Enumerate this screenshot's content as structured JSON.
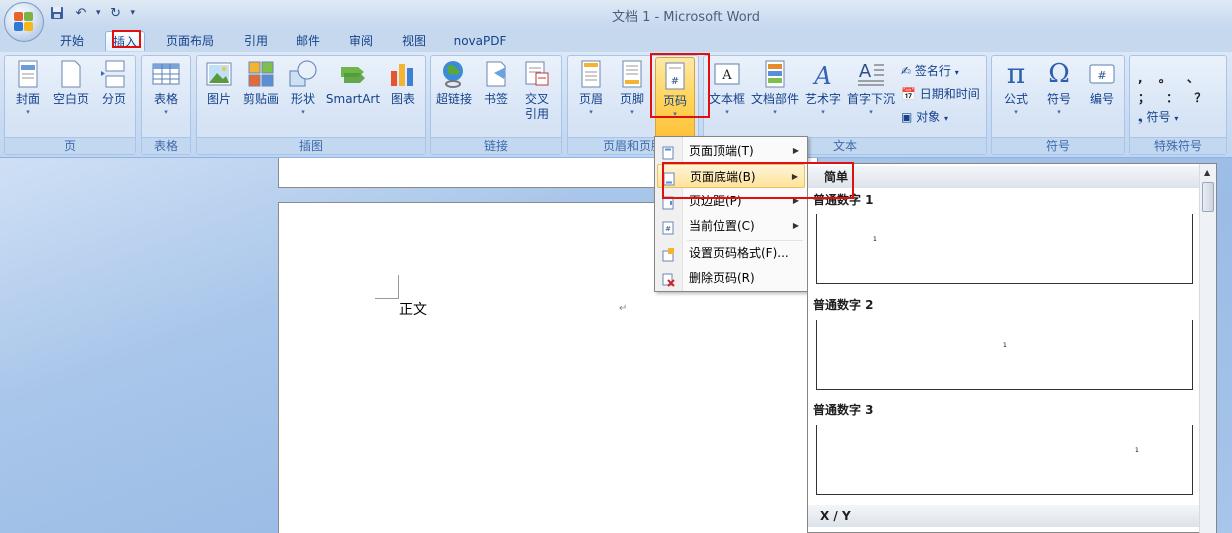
{
  "window": {
    "title": "文档 1 - Microsoft Word"
  },
  "tabs": [
    {
      "label": "开始",
      "active": false
    },
    {
      "label": "插入",
      "active": true
    },
    {
      "label": "页面布局",
      "active": false
    },
    {
      "label": "引用",
      "active": false
    },
    {
      "label": "邮件",
      "active": false
    },
    {
      "label": "审阅",
      "active": false
    },
    {
      "label": "视图",
      "active": false
    },
    {
      "label": "novaPDF",
      "active": false
    }
  ],
  "ribbon": {
    "groups": [
      {
        "label": "页",
        "buttons": [
          "封面",
          "空白页",
          "分页"
        ]
      },
      {
        "label": "表格",
        "buttons": [
          "表格"
        ]
      },
      {
        "label": "插图",
        "buttons": [
          "图片",
          "剪贴画",
          "形状",
          "SmartArt",
          "图表"
        ]
      },
      {
        "label": "链接",
        "buttons": [
          "超链接",
          "书签",
          "交叉",
          "引用"
        ]
      },
      {
        "label": "页眉和页脚",
        "buttons": [
          "页眉",
          "页脚",
          "页码"
        ]
      },
      {
        "label": "文本",
        "buttons": [
          "文本框",
          "文档部件",
          "艺术字",
          "首字下沉"
        ],
        "small": [
          "签名行",
          "日期和时间",
          "对象"
        ]
      },
      {
        "label": "符号",
        "buttons": [
          "公式",
          "符号",
          "编号"
        ]
      },
      {
        "label": "特殊符号",
        "small": [
          "符号"
        ]
      }
    ]
  },
  "special_symbols": ", 。 、 ； ： ？",
  "document": {
    "body_text": "正文",
    "para_mark": "↵"
  },
  "page_number_menu": {
    "items": [
      {
        "label": "页面顶端(T)",
        "submenu": true
      },
      {
        "label": "页面底端(B)",
        "submenu": true,
        "highlighted": true
      },
      {
        "label": "页边距(P)",
        "submenu": true
      },
      {
        "label": "当前位置(C)",
        "submenu": true
      },
      {
        "label": "设置页码格式(F)...",
        "submenu": false
      },
      {
        "label": "删除页码(R)",
        "submenu": false
      }
    ]
  },
  "gallery": {
    "section": "简单",
    "items": [
      {
        "label": "普通数字 1",
        "sample": "1"
      },
      {
        "label": "普通数字 2",
        "sample": "1"
      },
      {
        "label": "普通数字 3",
        "sample": "1"
      },
      {
        "label": "X / Y"
      }
    ]
  },
  "colors": {
    "highlight": "#e01010",
    "ribbon_blue": "#15428b"
  }
}
